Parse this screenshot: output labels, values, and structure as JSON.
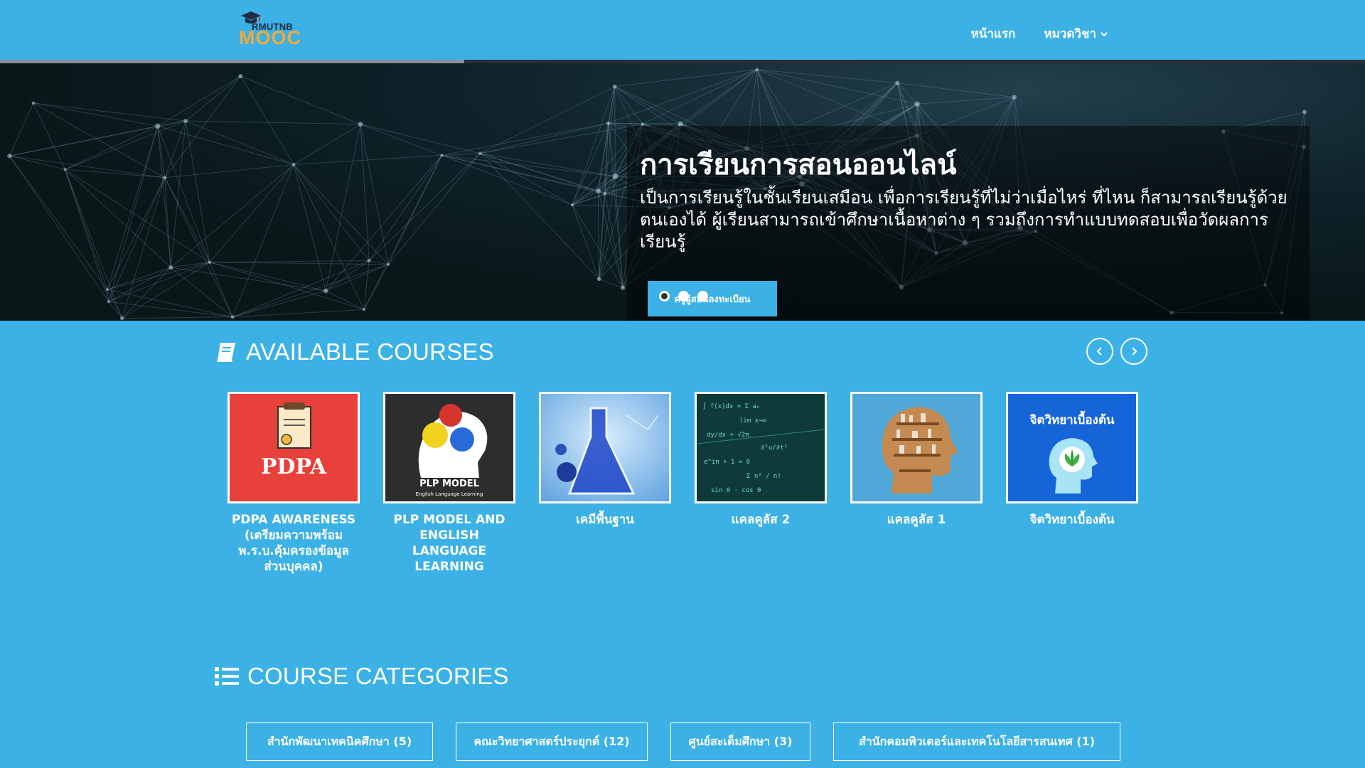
{
  "brand": {
    "top": "RMUTNB",
    "main": "MOOC"
  },
  "nav": {
    "home": "หน้าแรก",
    "categories": "หมวดวิชา"
  },
  "hero": {
    "progress_fraction": 0.34,
    "title": "การเรียนการสอนออนไลน์",
    "body": "เป็นการเรียนรู้ในชั้นเรียนเสมือน เพื่อการเรียนรู้ที่ไม่ว่าเมื่อไหร่ ที่ไหน ก็สามารถเรียนรู้ด้วยตนเองได้ ผู้เรียนสามารถเข้าศึกษาเนื้อหาต่าง ๆ รวมถึงการทำแบบทดสอบเพื่อวัดผลการเรียนรู้",
    "cta": "ครูผู้สอนลงทะเบียน",
    "slides": 3,
    "active_slide": 0
  },
  "courses_section": {
    "title": "AVAILABLE COURSES",
    "icon": "book-icon"
  },
  "courses": [
    {
      "title": "PDPA AWARENESS (เตรียมความพร้อม พ.ร.บ.คุ้มครองข้อมูลส่วนบุคคล)",
      "thumb_text": "PDPA",
      "thumb_bg": "#e8403a"
    },
    {
      "title": "PLP MODEL AND ENGLISH LANGUAGE LEARNING",
      "thumb_text": "PLP MODEL",
      "thumb_sub": "English Language Learning",
      "thumb_bg": "#2d2d2d"
    },
    {
      "title": "เคมีพื้นฐาน",
      "thumb_bg": "#7fb6e8"
    },
    {
      "title": "แคลคูลัส 2",
      "thumb_bg": "#0f3a3a"
    },
    {
      "title": "แคลคูลัส 1",
      "thumb_bg": "#4fa8d8"
    },
    {
      "title": "จิตวิทยาเบื้องต้น",
      "thumb_text": "จิตวิทยาเบื้องต้น",
      "thumb_bg": "#1565d8"
    }
  ],
  "categories_section": {
    "title": "COURSE CATEGORIES",
    "icon": "list-icon"
  },
  "categories": [
    "สำนักพัฒนาเทคนิคศึกษา (5)",
    "คณะวิทยาศาสตร์ประยุกต์ (12)",
    "ศูนย์สะเต็มศึกษา (3)",
    "สำนักคอมพิวเตอร์และเทคโนโลยีสารสนเทศ (1)"
  ],
  "colors": {
    "primary": "#3bb1e6",
    "hero_dark": "#0b1c22"
  }
}
